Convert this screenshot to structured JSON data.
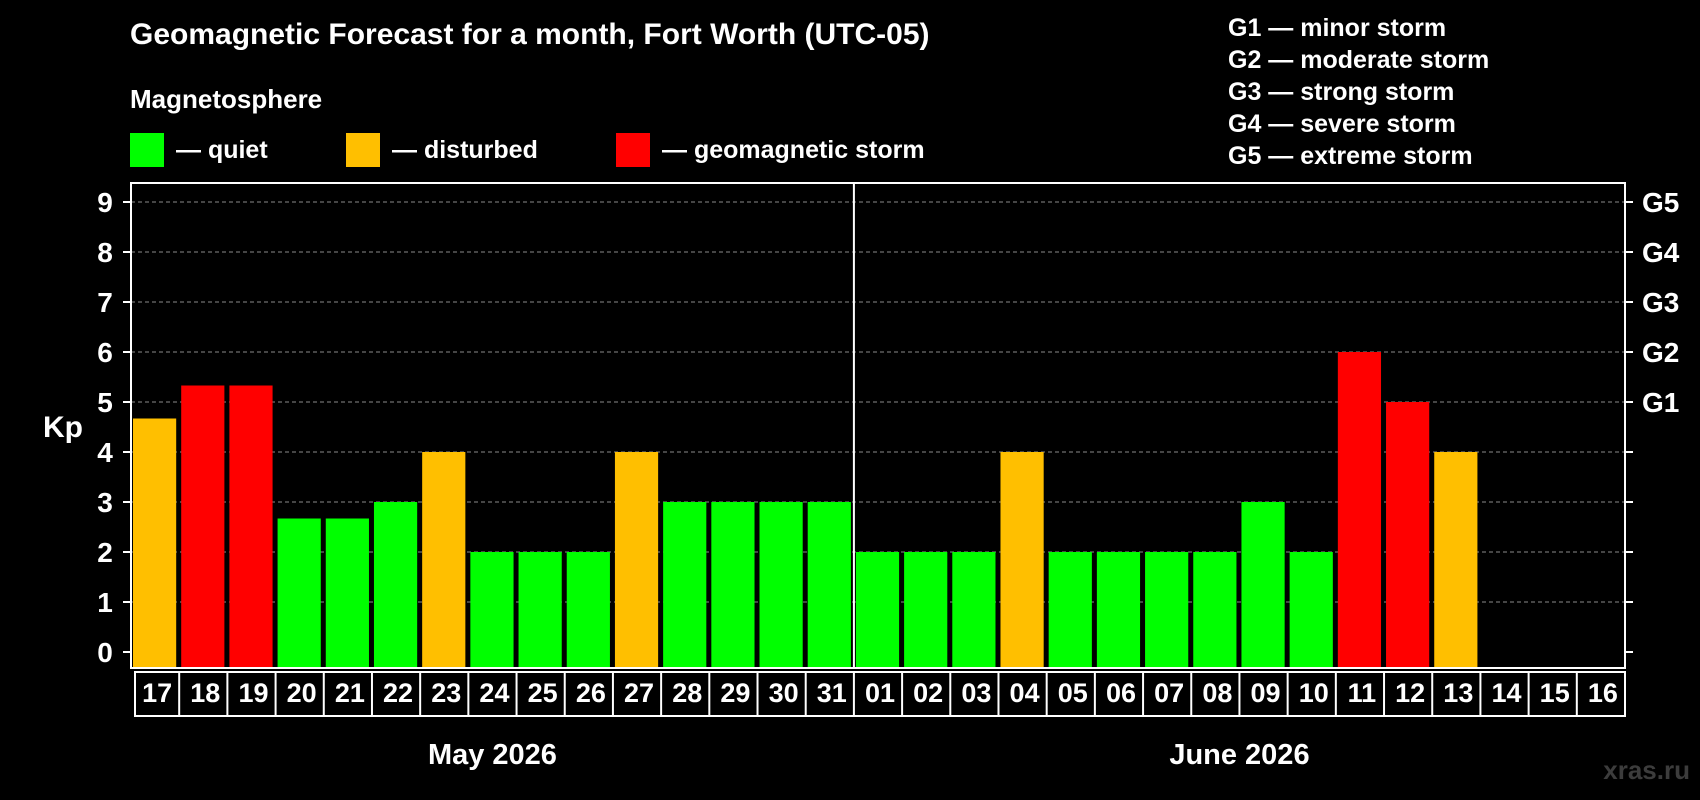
{
  "title": "Geomagnetic Forecast for a month, Fort Worth (UTC-05)",
  "legend": {
    "heading": "Magnetosphere",
    "items": [
      {
        "label": "— quiet",
        "color": "#00ff00"
      },
      {
        "label": "— disturbed",
        "color": "#ffbf00"
      },
      {
        "label": "— geomagnetic storm",
        "color": "#ff0000"
      }
    ]
  },
  "storm_scale": [
    "G1 — minor storm",
    "G2 — moderate storm",
    "G3 — strong storm",
    "G4 — severe storm",
    "G5 — extreme storm"
  ],
  "watermark": "xras.ru",
  "chart_data": {
    "type": "bar",
    "ylabel": "Kp",
    "ylim": [
      0,
      9
    ],
    "yticks": [
      "0",
      "1",
      "2",
      "3",
      "4",
      "5",
      "6",
      "7",
      "8",
      "9"
    ],
    "right_ticks": [
      {
        "value": 5,
        "label": "G1"
      },
      {
        "value": 6,
        "label": "G2"
      },
      {
        "value": 7,
        "label": "G3"
      },
      {
        "value": 8,
        "label": "G4"
      },
      {
        "value": 9,
        "label": "G5"
      }
    ],
    "grid": true,
    "categories": [
      "17",
      "18",
      "19",
      "20",
      "21",
      "22",
      "23",
      "24",
      "25",
      "26",
      "27",
      "28",
      "29",
      "30",
      "31",
      "01",
      "02",
      "03",
      "04",
      "05",
      "06",
      "07",
      "08",
      "09",
      "10",
      "11",
      "12",
      "13",
      "14",
      "15",
      "16"
    ],
    "values": [
      4.67,
      5.33,
      5.33,
      2.67,
      2.67,
      3,
      4,
      2,
      2,
      2,
      4,
      3,
      3,
      3,
      3,
      2,
      2,
      2,
      4,
      2,
      2,
      2,
      2,
      3,
      2,
      6,
      5,
      4,
      null,
      null,
      null
    ],
    "levels": [
      "disturbed",
      "storm",
      "storm",
      "quiet",
      "quiet",
      "quiet",
      "disturbed",
      "quiet",
      "quiet",
      "quiet",
      "disturbed",
      "quiet",
      "quiet",
      "quiet",
      "quiet",
      "quiet",
      "quiet",
      "quiet",
      "disturbed",
      "quiet",
      "quiet",
      "quiet",
      "quiet",
      "quiet",
      "quiet",
      "storm",
      "storm",
      "disturbed",
      null,
      null,
      null
    ],
    "level_colors": {
      "quiet": "#00ff00",
      "disturbed": "#ffbf00",
      "storm": "#ff0000"
    },
    "months": [
      {
        "label": "May 2026",
        "start": 0,
        "end": 14
      },
      {
        "label": "June 2026",
        "start": 15,
        "end": 30
      }
    ]
  }
}
